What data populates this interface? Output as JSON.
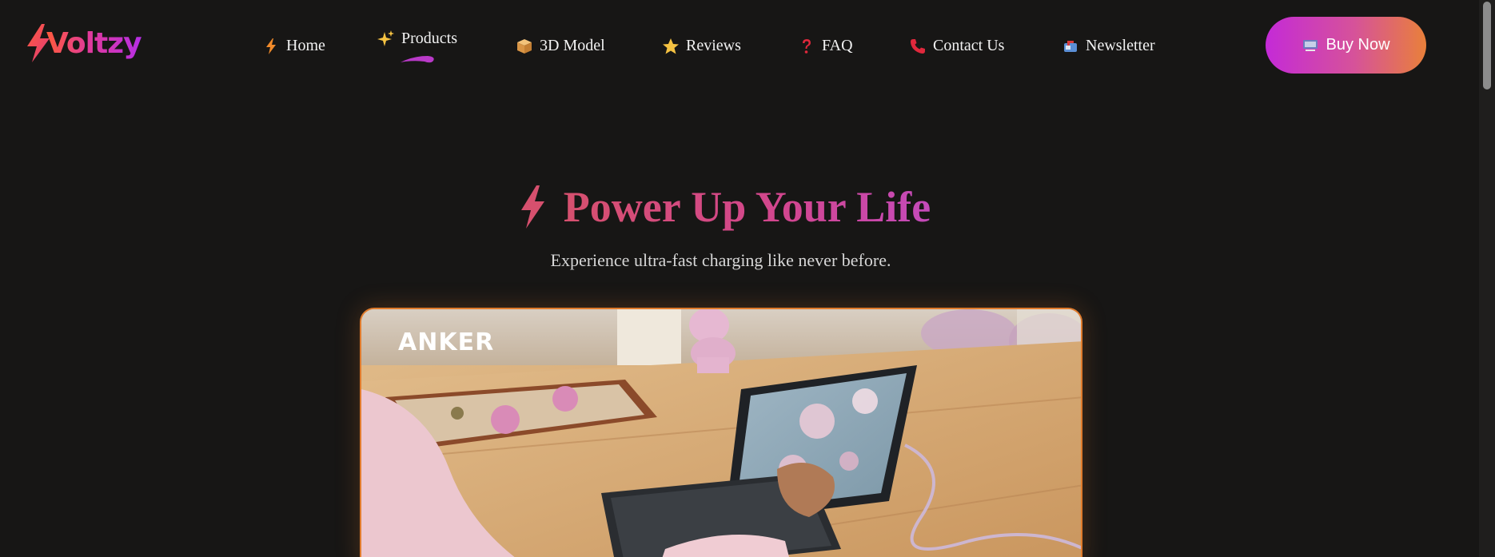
{
  "brand": {
    "name": "Voltzy"
  },
  "nav": {
    "items": [
      {
        "label": "Home",
        "icon": "lightning-icon"
      },
      {
        "label": "Products",
        "icon": "sparkles-icon",
        "active": true
      },
      {
        "label": "3D Model",
        "icon": "package-icon"
      },
      {
        "label": "Reviews",
        "icon": "star-icon"
      },
      {
        "label": "FAQ",
        "icon": "question-icon"
      },
      {
        "label": "Contact Us",
        "icon": "phone-icon"
      },
      {
        "label": "Newsletter",
        "icon": "mailbox-icon"
      }
    ],
    "cta": {
      "label": "Buy Now",
      "icon": "cart-icon"
    }
  },
  "hero": {
    "title": "Power Up Your Life",
    "subtitle": "Experience ultra-fast charging like never before.",
    "media_logo": "ANKER"
  },
  "colors": {
    "background": "#171615",
    "accent_orange": "#e07b2c",
    "accent_pink": "#d2468f",
    "accent_purple": "#c42ad7"
  }
}
